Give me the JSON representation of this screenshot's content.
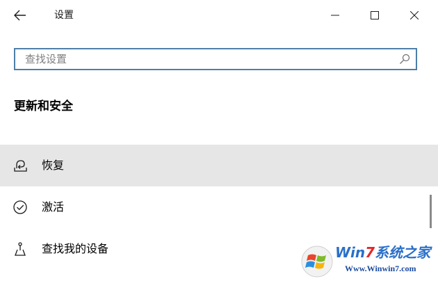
{
  "window": {
    "title": "设置"
  },
  "search": {
    "placeholder": "查找设置",
    "value": ""
  },
  "section": {
    "heading": "更新和安全"
  },
  "nav": {
    "items": [
      {
        "label": "恢复",
        "icon": "recovery-icon",
        "selected": true
      },
      {
        "label": "激活",
        "icon": "activation-icon",
        "selected": false
      },
      {
        "label": "查找我的设备",
        "icon": "find-device-icon",
        "selected": false
      }
    ]
  },
  "watermark": {
    "brand_prefix": "Win",
    "brand_seven": "7",
    "brand_suffix": "系统之家",
    "url": "Www.Winwin7.com"
  },
  "colors": {
    "search_border": "#4e7fa8",
    "selected_bg": "#e6e6e6",
    "scrollbar": "#8a8a8a"
  }
}
